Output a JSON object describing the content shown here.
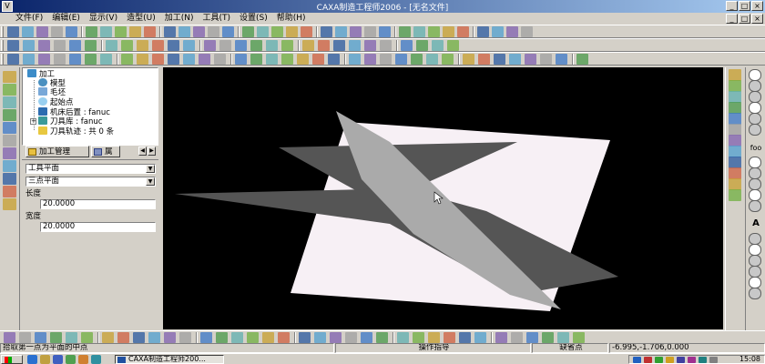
{
  "window": {
    "title": "CAXA制造工程师2006 - [无名文件]",
    "controls": [
      "_",
      "□",
      "×"
    ]
  },
  "menu": {
    "items": [
      "文件(F)",
      "编辑(E)",
      "显示(V)",
      "造型(U)",
      "加工(N)",
      "工具(T)",
      "设置(S)",
      "帮助(H)"
    ],
    "mdi_controls": [
      "_",
      "□",
      "×"
    ]
  },
  "tree": {
    "root": "加工",
    "items": [
      "模型",
      "毛坯",
      "起始点",
      "机床后置 : fanuc",
      "刀具库 : fanuc",
      "刀具轨迹 : 共 0 条"
    ],
    "expander": "+"
  },
  "tabs": {
    "manage": "加工管理",
    "attributes": "属"
  },
  "props": {
    "combo1": "工具平面",
    "combo2": "三点平面",
    "combo_arrow": "▼",
    "length_label": "长度",
    "length_value": "20.0000",
    "width_label": "宽度",
    "width_value": "20.0000"
  },
  "right_palette": {
    "text_tool": "foo",
    "letter_tool": "A"
  },
  "status": {
    "prompt": "拾取第一点为平面的中点",
    "hint": "操作指导",
    "snap": "缺省点",
    "coords": "-6.995,-1.706,0.000"
  },
  "taskbar": {
    "task": "CAXA制造工程师200...",
    "clock": "15:08"
  },
  "colors": {
    "viewport_bg": "#000000",
    "light_plane": "#f7f0f5",
    "dark_plane": "#555555",
    "diagonal_plane": "#aaaaaa",
    "titlebar_start": "#0a246a",
    "titlebar_end": "#a6caf0"
  },
  "icons": {
    "cursor": "arrow-cursor-icon",
    "start": "windows-start-icon"
  }
}
